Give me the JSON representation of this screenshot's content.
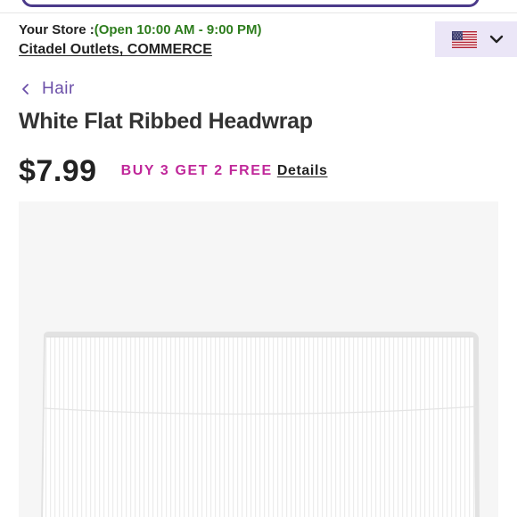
{
  "store": {
    "label": "Your Store :",
    "hours": "(Open 10:00 AM - 9:00 PM)",
    "location": "Citadel Outlets, COMMERCE"
  },
  "country_selector": {
    "flag_icon": "us-flag-icon",
    "chevron_icon": "chevron-down-icon",
    "background": "#ebe6f7"
  },
  "breadcrumb": {
    "icon": "chevron-left-icon",
    "label": "Hair"
  },
  "product": {
    "title": "White Flat Ribbed Headwrap",
    "price": "$7.99",
    "promo": "BUY 3 GET 2 FREE",
    "promo_link": "Details",
    "image_subject": "white ribbed headwrap"
  },
  "colors": {
    "accent": "#4b3a8a",
    "breadcrumb": "#6b4fa8",
    "promo": "#c0289a",
    "hours": "#2e7d1e"
  }
}
